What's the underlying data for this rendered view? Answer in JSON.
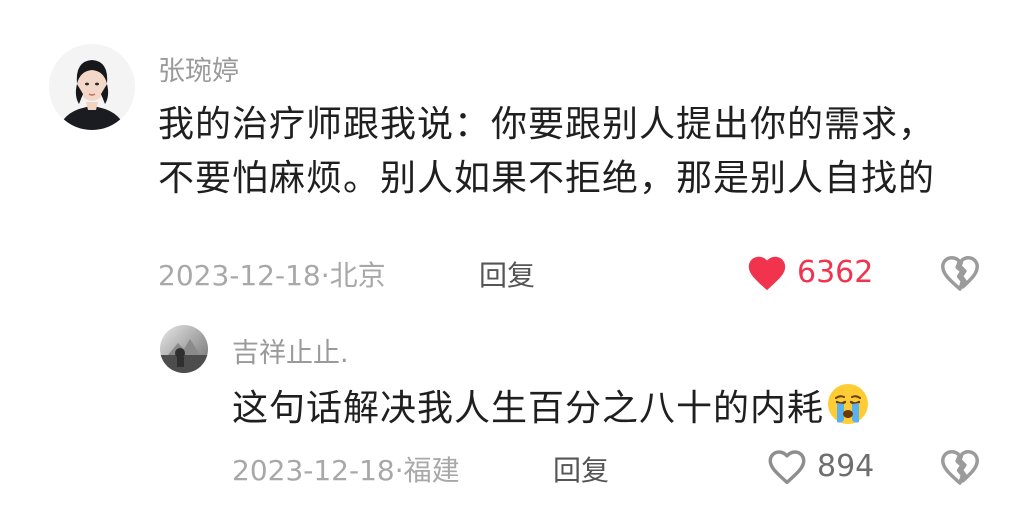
{
  "comments": [
    {
      "username": "张琬婷",
      "text": "我的治疗师跟我说：你要跟别人提出你的需求，不要怕麻烦。别人如果不拒绝，那是别人自找的",
      "date": "2023-12-18",
      "location": "北京",
      "reply_label": "回复",
      "like_count": "6362",
      "liked": true,
      "like_icon": "heart-filled-icon",
      "dislike_icon": "broken-heart-icon"
    },
    {
      "username": "吉祥止止.",
      "text": "这句话解决我人生百分之八十的内耗",
      "emoji": "crying-face-emoji",
      "date": "2023-12-18",
      "location": "福建",
      "reply_label": "回复",
      "like_count": "894",
      "liked": false,
      "like_icon": "heart-outline-icon",
      "dislike_icon": "broken-heart-icon"
    }
  ],
  "colors": {
    "like_active": "#f2334e",
    "meta_gray": "#a8a8a8",
    "icon_gray": "#9b9b9b"
  }
}
